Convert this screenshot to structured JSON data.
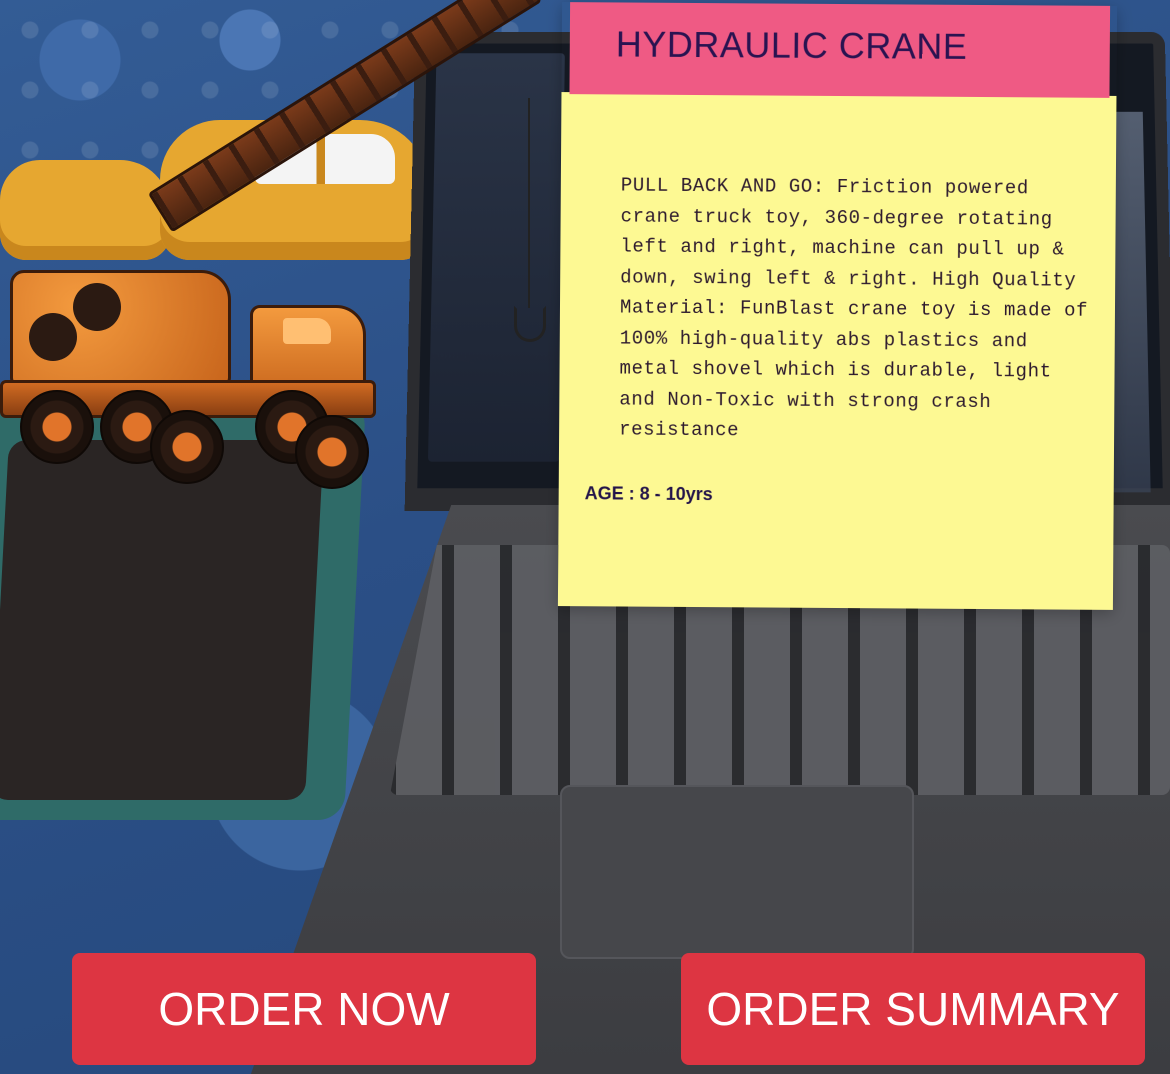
{
  "product_card": {
    "title": "HYDRAULIC CRANE",
    "description": "PULL BACK AND GO: Friction powered crane truck toy, 360-degree rotating left and right, machine can pull up & down, swing left & right. High Quality Material: FunBlast crane toy is made of 100% high-quality abs plastics and metal shovel which is durable, light and Non-Toxic with strong crash resistance",
    "age": "AGE : 8 - 10yrs",
    "header_color": "#ef5a84",
    "body_color": "#fdf993"
  },
  "ar_model": {
    "icon": "crane-model"
  },
  "actions": {
    "order_now_label": "ORDER NOW",
    "order_summary_label": "ORDER SUMMARY",
    "button_color": "#dd3542"
  }
}
